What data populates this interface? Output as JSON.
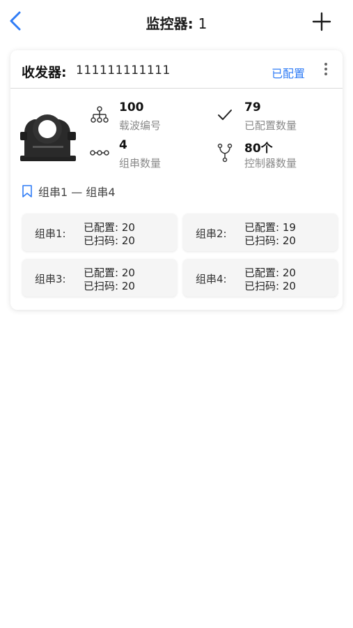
{
  "header": {
    "title": "监控器:",
    "title_number": "1"
  },
  "card": {
    "title": "收发器:",
    "serial": "111111111111",
    "status": "已配置",
    "stats": [
      {
        "icon": "network-tree-icon",
        "value": "100",
        "label": "载波编号"
      },
      {
        "icon": "checkmark-icon",
        "value": "79",
        "label": "已配置数量"
      },
      {
        "icon": "chain-nodes-icon",
        "value": "4",
        "label": "组串数量"
      },
      {
        "icon": "fork-icon",
        "value": "80个",
        "label": "控制器数量"
      }
    ],
    "range_text": "组串1 — 组串4",
    "strings": [
      {
        "name": "组串1:",
        "configured": "已配置: 20",
        "scanned": "已扫码: 20"
      },
      {
        "name": "组串2:",
        "configured": "已配置: 19",
        "scanned": "已扫码: 20"
      },
      {
        "name": "组串3:",
        "configured": "已配置: 20",
        "scanned": "已扫码: 20"
      },
      {
        "name": "组串4:",
        "configured": "已配置: 20",
        "scanned": "已扫码: 20"
      }
    ]
  },
  "colors": {
    "accent": "#2f7cf6",
    "text": "#1a1a1a",
    "muted": "#8a8a8a",
    "tile_bg": "#f5f5f5"
  }
}
